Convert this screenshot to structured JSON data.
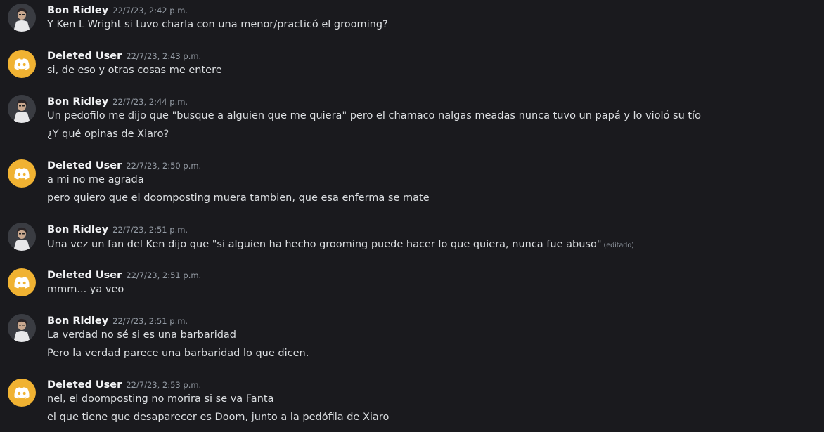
{
  "messages": [
    {
      "author": "Bon Ridley",
      "timestamp": "22/7/23, 2:42 p.m.",
      "avatar": "bon-ridley-avatar",
      "lines": [
        "Y Ken L Wright si tuvo charla con una menor/practicó el grooming?"
      ]
    },
    {
      "author": "Deleted User",
      "timestamp": "22/7/23, 2:43 p.m.",
      "avatar": "discord-logo-icon",
      "lines": [
        "si, de eso y otras cosas me entere"
      ]
    },
    {
      "author": "Bon Ridley",
      "timestamp": "22/7/23, 2:44 p.m.",
      "avatar": "bon-ridley-avatar",
      "lines": [
        "Un pedofilo me dijo que \"busque a alguien que me quiera\" pero el chamaco nalgas meadas nunca tuvo un papá y lo violó su tío",
        "¿Y qué opinas de Xiaro?"
      ]
    },
    {
      "author": "Deleted User",
      "timestamp": "22/7/23, 2:50 p.m.",
      "avatar": "discord-logo-icon",
      "lines": [
        "a mi no me agrada",
        "pero quiero que el doomposting muera tambien, que esa enferma se mate"
      ]
    },
    {
      "author": "Bon Ridley",
      "timestamp": "22/7/23, 2:51 p.m.",
      "avatar": "bon-ridley-avatar",
      "lines": [
        "Una vez un fan del Ken dijo que \"si alguien ha hecho grooming puede hacer lo que quiera, nunca fue abuso\""
      ],
      "edited": "(editado)"
    },
    {
      "author": "Deleted User",
      "timestamp": "22/7/23, 2:51 p.m.",
      "avatar": "discord-logo-icon",
      "lines": [
        "mmm... ya veo"
      ]
    },
    {
      "author": "Bon Ridley",
      "timestamp": "22/7/23, 2:51 p.m.",
      "avatar": "bon-ridley-avatar",
      "lines": [
        "La verdad no sé si es una barbaridad",
        "Pero la verdad parece una barbaridad lo que dicen."
      ]
    },
    {
      "author": "Deleted User",
      "timestamp": "22/7/23, 2:53 p.m.",
      "avatar": "discord-logo-icon",
      "lines": [
        "nel, el doomposting no morira si se va Fanta",
        "el que tiene que desaparecer es Doom, junto a la pedófila de Xiaro"
      ]
    }
  ],
  "colors": {
    "background": "#1a1a1e",
    "author": "#f2f3f5",
    "text": "#dbdee1",
    "timestamp": "#949ba4",
    "deleted_avatar": "#f0b232"
  }
}
